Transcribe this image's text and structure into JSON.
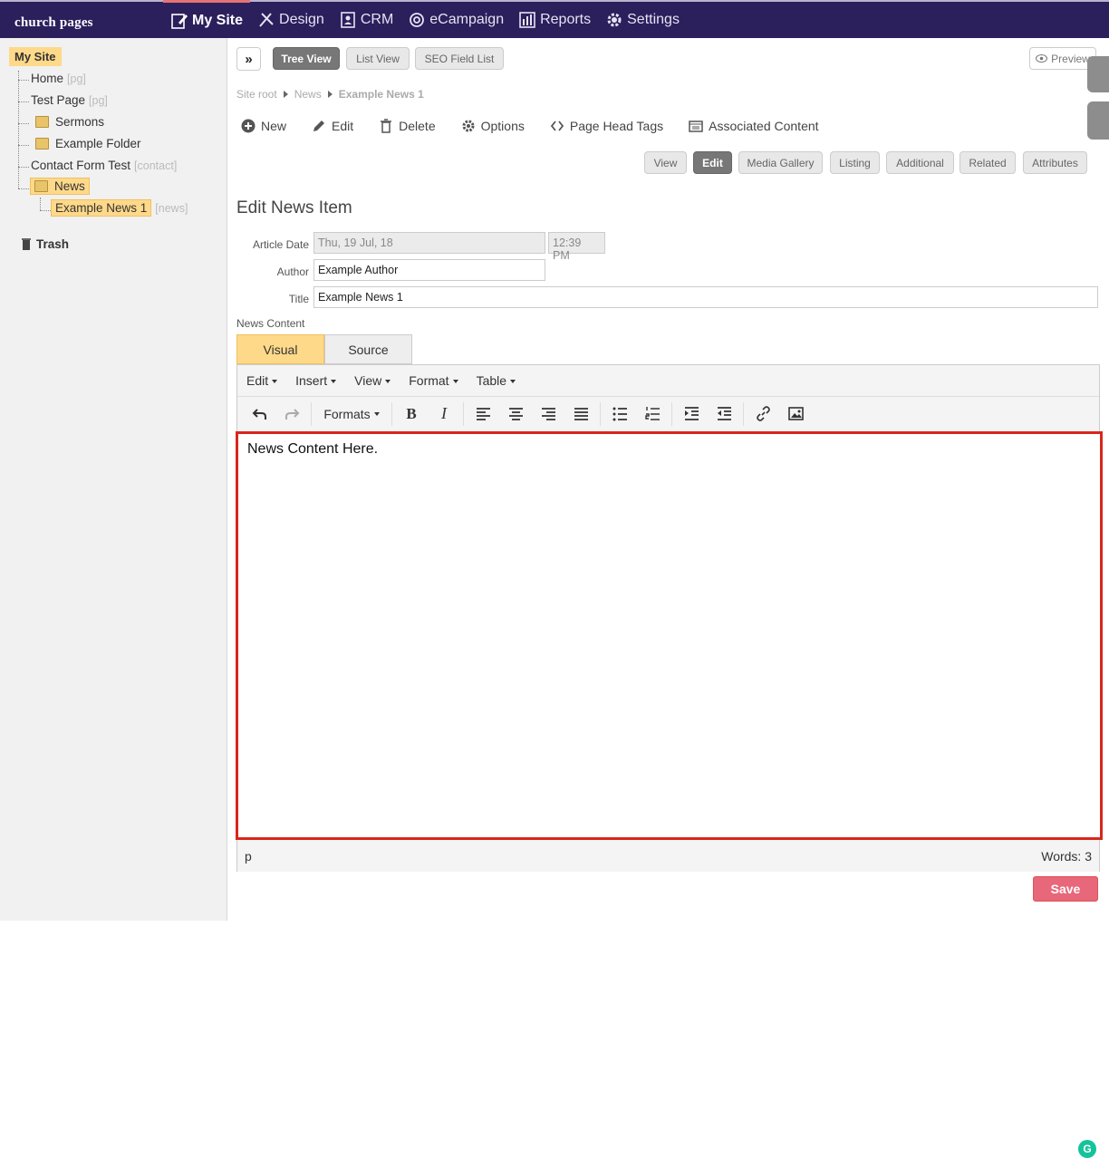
{
  "app": {
    "logo": "church pages"
  },
  "nav": {
    "items": [
      {
        "label": "My Site",
        "icon": "page-edit-icon"
      },
      {
        "label": "Design",
        "icon": "design-tools-icon"
      },
      {
        "label": "CRM",
        "icon": "contacts-icon"
      },
      {
        "label": "eCampaign",
        "icon": "at-sign-icon"
      },
      {
        "label": "Reports",
        "icon": "bar-chart-icon"
      },
      {
        "label": "Settings",
        "icon": "gear-icon"
      }
    ],
    "active": "My Site"
  },
  "tree": {
    "root": "My Site",
    "items": [
      {
        "label": "Home",
        "tag": "[pg]"
      },
      {
        "label": "Test Page",
        "tag": "[pg]"
      },
      {
        "label": "Sermons",
        "tag": ""
      },
      {
        "label": "Example Folder",
        "tag": ""
      },
      {
        "label": "Contact Form Test",
        "tag": "[contact]"
      },
      {
        "label": "News",
        "tag": ""
      },
      {
        "label": "Example News 1",
        "tag": "[news]"
      }
    ],
    "trash": "Trash"
  },
  "views": {
    "toggle": "»",
    "tree": "Tree View",
    "list": "List View",
    "seo": "SEO Field List",
    "preview": "Preview"
  },
  "breadcrumb": {
    "root": "Site root",
    "parent": "News",
    "current": "Example News 1"
  },
  "actions": {
    "new": "New",
    "edit": "Edit",
    "delete": "Delete",
    "options": "Options",
    "head_tags": "Page Head Tags",
    "associated": "Associated Content"
  },
  "subtabs": [
    "View",
    "Edit",
    "Media Gallery",
    "Listing",
    "Additional",
    "Related",
    "Attributes"
  ],
  "form": {
    "heading": "Edit News Item",
    "date_label": "Article Date",
    "date_value": "Thu, 19 Jul, 18",
    "time_value": "12:39 PM",
    "author_label": "Author",
    "author_value": "Example Author",
    "title_label": "Title",
    "title_value": "Example News 1",
    "content_label": "News Content"
  },
  "editor": {
    "tab_visual": "Visual",
    "tab_source": "Source",
    "menu": [
      "Edit",
      "Insert",
      "View",
      "Format",
      "Table"
    ],
    "formats": "Formats",
    "content": "News Content Here.",
    "path": "p",
    "word_count": "Words: 3"
  },
  "save_label": "Save",
  "colors": {
    "topbar": "#2b1f5c",
    "highlight": "#ffd98a",
    "save": "#e8677a",
    "focus_border": "#d9261c"
  }
}
